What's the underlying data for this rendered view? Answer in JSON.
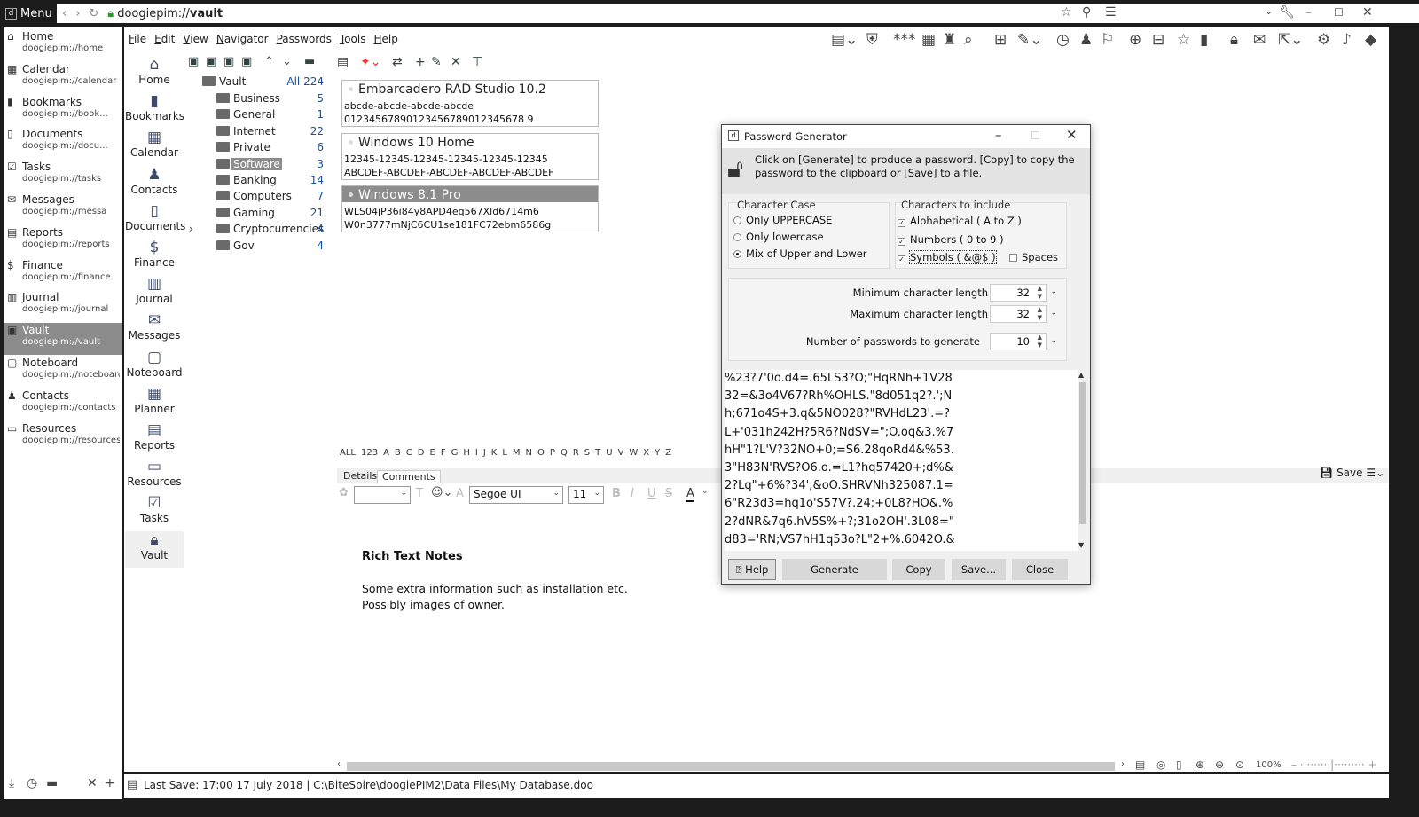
{
  "browser": {
    "menu_label": "Menu",
    "address_scheme": "doogiepim://",
    "address_path": "vault"
  },
  "nav": [
    {
      "title": "Home",
      "url": "doogiepim://home",
      "icon": "home-icon"
    },
    {
      "title": "Calendar",
      "url": "doogiepim://calendar",
      "icon": "calendar-icon"
    },
    {
      "title": "Bookmarks",
      "url": "doogiepim://book...",
      "icon": "bookmark-icon"
    },
    {
      "title": "Documents",
      "url": "doogiepim://docu...",
      "icon": "document-icon"
    },
    {
      "title": "Tasks",
      "url": "doogiepim://tasks",
      "icon": "tasks-icon"
    },
    {
      "title": "Messages",
      "url": "doogiepim://messa",
      "icon": "envelope-icon"
    },
    {
      "title": "Reports",
      "url": "doogiepim://reports",
      "icon": "reports-icon"
    },
    {
      "title": "Finance",
      "url": "doogiepim://finance",
      "icon": "finance-icon"
    },
    {
      "title": "Journal",
      "url": "doogiepim://journal",
      "icon": "journal-icon"
    },
    {
      "title": "Vault",
      "url": "doogiepim://vault",
      "icon": "vault-icon"
    },
    {
      "title": "Noteboard",
      "url": "doogiepim://noteboard",
      "icon": "noteboard-icon"
    },
    {
      "title": "Contacts",
      "url": "doogiepim://contacts",
      "icon": "contacts-icon"
    },
    {
      "title": "Resources",
      "url": "doogiepim://resources",
      "icon": "resources-icon"
    }
  ],
  "menubar": [
    "File",
    "Edit",
    "View",
    "Navigator",
    "Passwords",
    "Tools",
    "Help"
  ],
  "icon_column": [
    "Home",
    "Bookmarks",
    "Calendar",
    "Contacts",
    "Documents",
    "Finance",
    "Journal",
    "Messages",
    "Noteboard",
    "Planner",
    "Reports",
    "Resources",
    "Tasks",
    "Vault"
  ],
  "tree": {
    "root": {
      "name": "Vault",
      "count": "All 224"
    },
    "folders": [
      {
        "name": "Business",
        "count": "5"
      },
      {
        "name": "General",
        "count": "1"
      },
      {
        "name": "Internet",
        "count": "22"
      },
      {
        "name": "Private",
        "count": "6"
      },
      {
        "name": "Software",
        "count": "3"
      },
      {
        "name": "Banking",
        "count": "14"
      },
      {
        "name": "Computers",
        "count": "7"
      },
      {
        "name": "Gaming",
        "count": "21"
      },
      {
        "name": "Cryptocurrencies",
        "count": "4"
      },
      {
        "name": "Gov",
        "count": "4"
      }
    ]
  },
  "cards": [
    {
      "title": "Embarcadero RAD Studio 10.2",
      "line1": "abcde-abcde-abcde-abcde",
      "line2": "01234567890123456789012345678 9"
    },
    {
      "title": "Windows 10 Home",
      "line1": "12345-12345-12345-12345-12345-12345",
      "line2": "ABCDEF-ABCDEF-ABCDEF-ABCDEF-ABCDEF"
    },
    {
      "title": "Windows 8.1 Pro",
      "line1": "WLS04jP36i84y8APD4eq567Xld6714m6",
      "line2": "W0n3777mNjC6CU1se181FC72ebm6586g"
    }
  ],
  "alphabet": [
    "ALL",
    "123",
    "A",
    "B",
    "C",
    "D",
    "E",
    "F",
    "G",
    "H",
    "I",
    "J",
    "K",
    "L",
    "M",
    "N",
    "O",
    "P",
    "Q",
    "R",
    "S",
    "T",
    "U",
    "V",
    "W",
    "X",
    "Y",
    "Z"
  ],
  "tabs": [
    "Details",
    "Comments"
  ],
  "format": {
    "font": "Segoe UI",
    "size": "11"
  },
  "save_label": "Save",
  "notes": {
    "title": "Rich Text Notes",
    "line1": "Some extra information such as installation etc.",
    "line2": "Possibly images of owner."
  },
  "zoom": "100%",
  "status": "Last Save: 17:00 17 July 2018 | C:\\BiteSpire\\doogiePIM2\\Data Files\\My Database.doo",
  "dialog": {
    "title": "Password Generator",
    "info1": "Click on [Generate] to produce a password. [Copy] to copy the",
    "info2": "password to the clipboard or [Save] to a file.",
    "case_group": "Character Case",
    "case_options": [
      "Only UPPERCASE",
      "Only lowercase",
      "Mix of Upper and Lower"
    ],
    "chars_group": "Characters to include",
    "char_options": [
      "Alphabetical ( A to Z )",
      "Numbers ( 0 to 9 )",
      "Symbols ( &@$ )",
      "Spaces"
    ],
    "min_label": "Minimum character length",
    "min_value": "32",
    "max_label": "Maximum character length",
    "max_value": "32",
    "count_label": "Number of passwords to generate",
    "count_value": "10",
    "passwords": [
      "%23?7'0o.d4=.65LS3?O;\"HqRNh+1V28",
      "32=&3o4V67?Rh%OHLS.\"8d051q2?.';N",
      "h;671o4S+3.q&5NO028?\"RVHdL23'.=?",
      "L+'031h242H?5R6?NdSV=\";O.oq&3.%7",
      "hH\"1?L'V?32NO+0;=S6.28qoRd4&%53.",
      "3\"H83N'RVS?O6.o.=L1?hq57420+;d%&",
      "2?Lq\"+6%?34';&oO.SHRVNh325087.1=",
      "6\"R23d3=hq1o'S57V?.24;+0L8?HO&.%",
      "2?dNR&7q6.hV5S%+?;31o2OH'.3L08=\"",
      "d83='RN;VS7hH1q53o?L\"2+%.6042O.&"
    ],
    "buttons": {
      "help": "Help",
      "generate": "Generate",
      "copy": "Copy",
      "save": "Save...",
      "close": "Close"
    }
  }
}
